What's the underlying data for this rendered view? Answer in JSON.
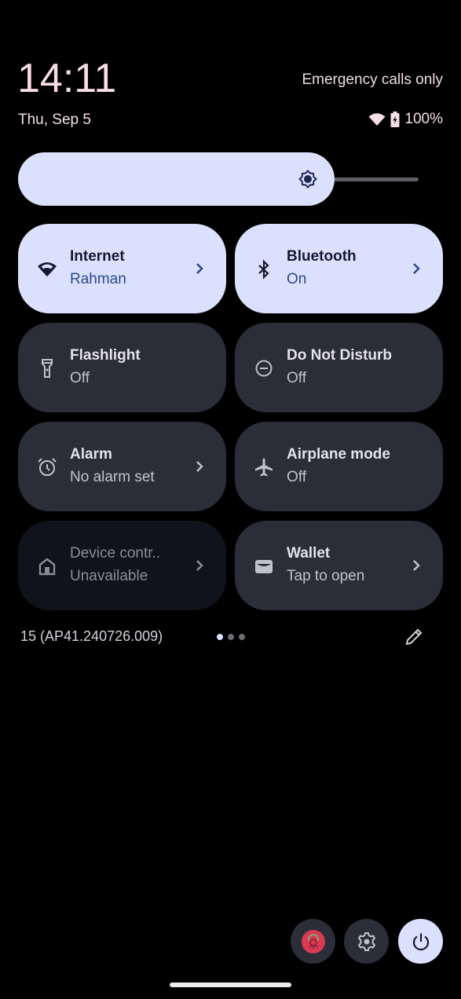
{
  "status_bar": {
    "time": "14:11",
    "date": "Thu, Sep 5",
    "carrier": "Emergency calls only",
    "battery": "100%",
    "icons": [
      "wifi-icon",
      "battery-charging-icon"
    ]
  },
  "brightness": {
    "level": 0.79,
    "icon": "brightness-icon"
  },
  "tiles": [
    {
      "label": "Internet",
      "sub": "Rahman",
      "state": "active",
      "icon": "wifi-icon",
      "chevron": true
    },
    {
      "label": "Bluetooth",
      "sub": "On",
      "state": "active",
      "icon": "bluetooth-icon",
      "chevron": true
    },
    {
      "label": "Flashlight",
      "sub": "Off",
      "state": "inactive",
      "icon": "flashlight-icon",
      "chevron": false
    },
    {
      "label": "Do Not Disturb",
      "sub": "Off",
      "state": "inactive",
      "icon": "do-not-disturb-icon",
      "chevron": false
    },
    {
      "label": "Alarm",
      "sub": "No alarm set",
      "state": "inactive",
      "icon": "alarm-icon",
      "chevron": true
    },
    {
      "label": "Airplane mode",
      "sub": "Off",
      "state": "inactive",
      "icon": "airplane-icon",
      "chevron": false
    },
    {
      "label": "Device contr..",
      "sub": "Unavailable",
      "state": "disabled",
      "icon": "home-icon",
      "chevron": true
    },
    {
      "label": "Wallet",
      "sub": "Tap to open",
      "state": "inactive",
      "icon": "wallet-icon",
      "chevron": true
    }
  ],
  "footer": {
    "build": "15 (AP41.240726.009)",
    "pages": 3,
    "current_page": 1,
    "edit_icon": "pencil-icon"
  },
  "bottom_buttons": [
    {
      "name": "user-avatar",
      "icon": "avatar-icon"
    },
    {
      "name": "settings",
      "icon": "gear-icon"
    },
    {
      "name": "power",
      "icon": "power-icon"
    }
  ],
  "colors": {
    "accent": "#dbe1fd",
    "tile_inactive": "#2b2d38",
    "tile_disabled": "#11131a",
    "background": "#000000"
  }
}
